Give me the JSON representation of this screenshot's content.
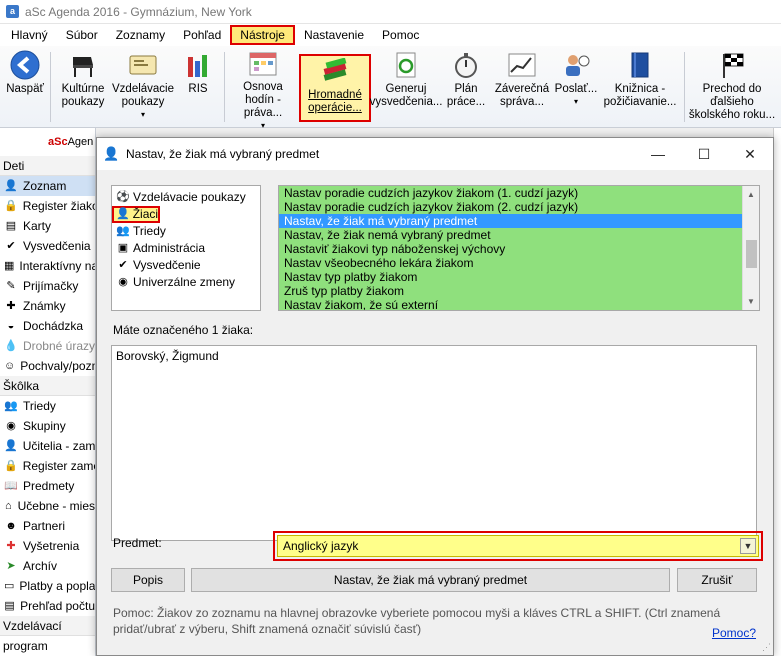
{
  "window": {
    "title": "aSc Agenda 2016 - Gymnázium, New York",
    "app_icon": "asc-agenda-icon"
  },
  "menu": [
    "Hlavný",
    "Súbor",
    "Zoznamy",
    "Pohľad",
    "Nástroje",
    "Nastavenie",
    "Pomoc"
  ],
  "ribbon": {
    "back": "Naspäť",
    "kulturne": "Kultúrne poukazy",
    "vzdelavacie": "Vzdelávacie poukazy",
    "ris": "RIS",
    "osnova": "Osnova hodín - práva...",
    "hromadne": "Hromadné operácie...",
    "generuj": "Generuj vysvedčenia...",
    "plan": "Plán práce...",
    "zaverecna": "Záverečná správa...",
    "poslat": "Poslať...",
    "kniznica": "Knižnica - požičiavanie...",
    "prechod": "Prechod do ďalšieho školského roku..."
  },
  "sidebar": {
    "brand_red": "aSc",
    "brand_rest": "Agen",
    "sections": [
      {
        "head": "Deti",
        "items": [
          "Zoznam",
          "Register žiako",
          "Karty",
          "Vysvedčenia",
          "Interaktívny na",
          "Prijímačky",
          "Známky",
          "Dochádzka",
          "Drobné úrazy",
          "Pochvaly/pozn"
        ]
      },
      {
        "head": "Škôlka",
        "items": [
          "Triedy",
          "Skupiny",
          "Učitelia - zame",
          "Register zame",
          "Predmety",
          "Učebne - mies",
          "Partneri",
          "Vyšetrenia",
          "Archív",
          "Platby a popla",
          "Prehľad počtu",
          "Vzdelávací program"
        ]
      }
    ]
  },
  "dialog": {
    "title": "Nastav, že žiak má vybraný predmet",
    "tree": [
      "Vzdelávacie poukazy",
      "Žiaci",
      "Triedy",
      "Administrácia",
      "Vysvedčenie",
      "Univerzálne zmeny"
    ],
    "actions": [
      "Nastav poradie cudzích jazykov žiakom (1. cudzí jazyk)",
      "Nastav poradie cudzích jazykov žiakom (2. cudzí jazyk)",
      "Nastav, že žiak má vybraný predmet",
      "Nastav, že žiak nemá vybraný predmet",
      "Nastaviť žiakovi typ náboženskej výchovy",
      "Nastav všeobecného lekára žiakom",
      "Nastav typ platby žiakom",
      "Zruš typ platby žiakom",
      "Nastav žiakom, že sú externí"
    ],
    "selected_action_index": 2,
    "count_label": "Máte označeného 1 žiaka:",
    "students": [
      "Borovský, Žigmund"
    ],
    "predmet_label": "Predmet:",
    "predmet_value": "Anglický jazyk",
    "btn_popis": "Popis",
    "btn_apply": "Nastav, že žiak má vybraný predmet",
    "btn_cancel": "Zrušiť",
    "help_text": "Pomoc: Žiakov zo zoznamu na hlavnej obrazovke vyberiete pomocou myši a kláves CTRL a SHIFT. (Ctrl znamená pridať/ubrať z výberu, Shift znamená označiť súvislú časť)",
    "help_link": "Pomoc?"
  },
  "colors": {
    "highlight_red": "#d00000",
    "selection_blue": "#3399ff",
    "action_green": "#8fe07d",
    "predmet_yellow": "#ffff8a"
  }
}
